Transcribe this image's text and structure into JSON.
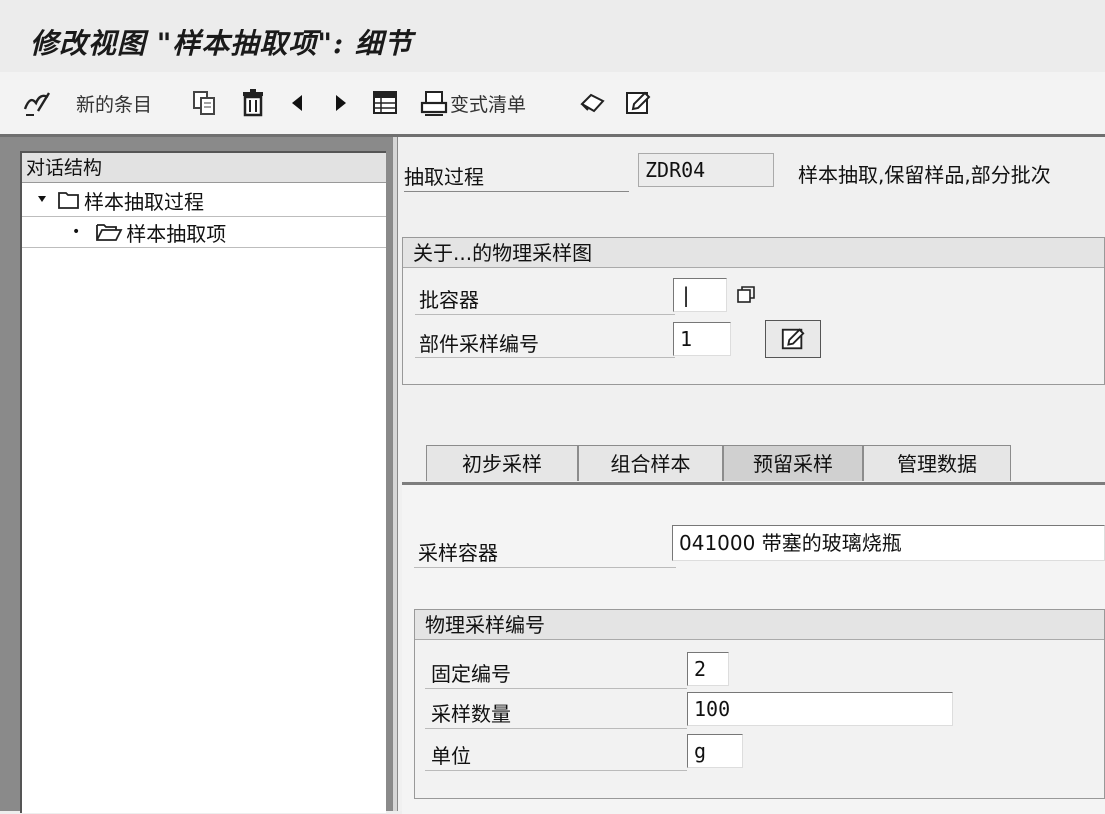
{
  "window": {
    "title": "修改视图 \"样本抽取项\": 细节"
  },
  "toolbar": {
    "new_entry_label": "新的条目",
    "print_label": "变式清单"
  },
  "tree": {
    "header": "对话结构",
    "items": [
      {
        "label": "样本抽取过程",
        "expanded": true
      },
      {
        "label": "样本抽取项"
      }
    ]
  },
  "header_fields": {
    "procedure_label": "抽取过程",
    "procedure_value": "ZDR04",
    "procedure_desc": "样本抽取,保留样品,部分批次"
  },
  "physical_sample": {
    "title": "关于...的物理采样图",
    "batch_container_label": "批容器",
    "batch_container_value": "|",
    "part_sample_no_label": "部件采样编号",
    "part_sample_no_value": "1"
  },
  "tabs": [
    {
      "label": "初步采样",
      "active": false
    },
    {
      "label": "组合样本",
      "active": false
    },
    {
      "label": "预留采样",
      "active": true
    },
    {
      "label": "管理数据",
      "active": false
    }
  ],
  "tab_content": {
    "container_label": "采样容器",
    "container_value": "041000 带塞的玻璃烧瓶",
    "numbering": {
      "title": "物理采样编号",
      "fixed_no_label": "固定编号",
      "fixed_no_value": "2",
      "quantity_label": "采样数量",
      "quantity_value": "100",
      "unit_label": "单位",
      "unit_value": "g"
    }
  }
}
